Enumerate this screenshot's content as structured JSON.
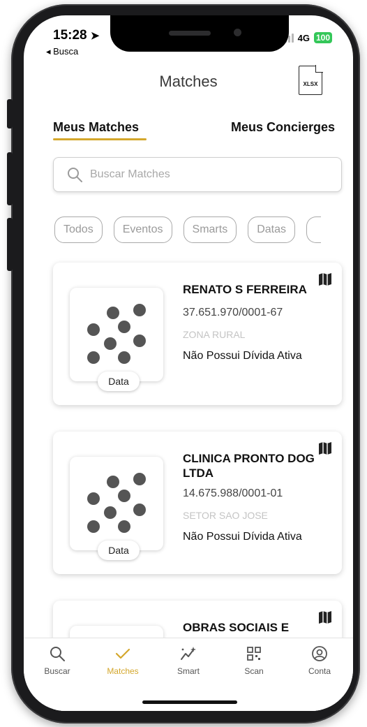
{
  "status_bar": {
    "time": "15:28",
    "back_label": "◂ Busca",
    "network": "4G",
    "battery": "100"
  },
  "header": {
    "title": "Matches",
    "export_label": "XLSX"
  },
  "tabs": [
    {
      "label": "Meus Matches",
      "active": true
    },
    {
      "label": "Meus Concierges",
      "active": false
    }
  ],
  "search": {
    "placeholder": "Buscar Matches",
    "value": ""
  },
  "filters": [
    "Todos",
    "Eventos",
    "Smarts",
    "Datas"
  ],
  "cards": [
    {
      "name": "RENATO S FERREIRA",
      "document": "37.651.970/0001-67",
      "address": "ZONA RURAL",
      "debt_status": "Não Possui Dívida Ativa",
      "badge": "Data"
    },
    {
      "name": "CLINICA PRONTO DOG  LTDA",
      "document": "14.675.988/0001-01",
      "address": "SETOR SAO JOSE",
      "debt_status": "Não Possui Dívida Ativa",
      "badge": "Data"
    },
    {
      "name": "OBRAS SOCIAIS E EDUCACIONAIS DE",
      "document": "",
      "address": "",
      "debt_status": "",
      "badge": ""
    }
  ],
  "tab_bar": [
    {
      "label": "Buscar",
      "icon": "search-icon",
      "active": false
    },
    {
      "label": "Matches",
      "icon": "check-icon",
      "active": true
    },
    {
      "label": "Smart",
      "icon": "sparkle-trend-icon",
      "active": false
    },
    {
      "label": "Scan",
      "icon": "qr-code-icon",
      "active": false
    },
    {
      "label": "Conta",
      "icon": "user-circle-icon",
      "active": false
    }
  ],
  "colors": {
    "accent": "#D4A72C",
    "battery": "#34C759"
  }
}
